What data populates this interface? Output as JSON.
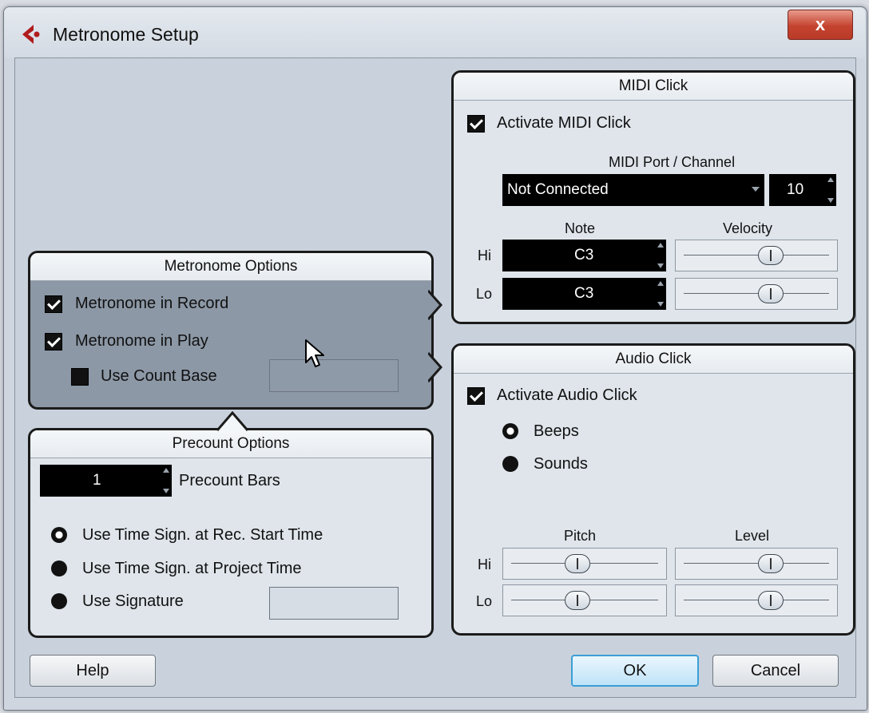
{
  "window": {
    "title": "Metronome Setup",
    "close_symbol": "x"
  },
  "midi_click": {
    "title": "MIDI Click",
    "activate_label": "Activate MIDI Click",
    "port_channel_label": "MIDI Port / Channel",
    "port_value": "Not Connected",
    "channel_value": "10",
    "note_label": "Note",
    "velocity_label": "Velocity",
    "hi_label": "Hi",
    "lo_label": "Lo",
    "hi_note": "C3",
    "lo_note": "C3"
  },
  "metronome_options": {
    "title": "Metronome Options",
    "in_record_label": "Metronome in Record",
    "in_play_label": "Metronome in Play",
    "count_base_label": "Use Count Base"
  },
  "audio_click": {
    "title": "Audio Click",
    "activate_label": "Activate Audio Click",
    "beeps_label": "Beeps",
    "sounds_label": "Sounds",
    "pitch_label": "Pitch",
    "level_label": "Level",
    "hi_label": "Hi",
    "lo_label": "Lo"
  },
  "precount_options": {
    "title": "Precount Options",
    "bars_value": "1",
    "bars_label": "Precount Bars",
    "time_sign_rec_label": "Use Time Sign. at Rec. Start Time",
    "time_sign_project_label": "Use Time Sign. at Project Time",
    "use_signature_label": "Use Signature"
  },
  "buttons": {
    "help": "Help",
    "ok": "OK",
    "cancel": "Cancel"
  }
}
